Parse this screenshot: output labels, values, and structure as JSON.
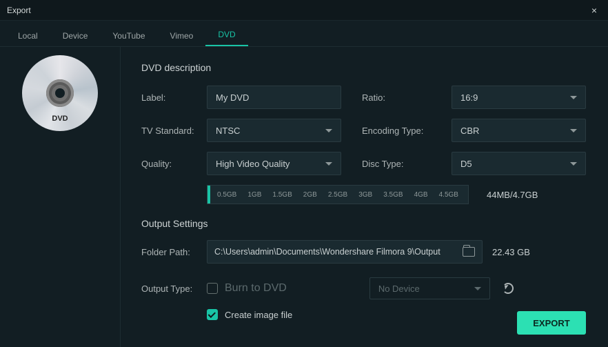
{
  "window": {
    "title": "Export"
  },
  "tabs": {
    "local": "Local",
    "device": "Device",
    "youtube": "YouTube",
    "vimeo": "Vimeo",
    "dvd": "DVD"
  },
  "disc": {
    "label": "DVD"
  },
  "section": {
    "desc": "DVD description",
    "output": "Output Settings"
  },
  "labels": {
    "label": "Label:",
    "tvstd": "TV Standard:",
    "quality": "Quality:",
    "ratio": "Ratio:",
    "encoding": "Encoding Type:",
    "disctype": "Disc Type:",
    "folder": "Folder Path:",
    "outputtype": "Output Type:"
  },
  "values": {
    "label": "My DVD",
    "tvstd": "NTSC",
    "quality": "High Video Quality",
    "ratio": "16:9",
    "encoding": "CBR",
    "disctype": "D5",
    "path": "C:\\Users\\admin\\Documents\\Wondershare Filmora 9\\Output",
    "free": "22.43 GB",
    "size": "44MB/4.7GB",
    "burn": "Burn to DVD",
    "nodevice": "No Device",
    "createimg": "Create image file"
  },
  "gauge": {
    "ticks": [
      "0.5GB",
      "1GB",
      "1.5GB",
      "2GB",
      "2.5GB",
      "3GB",
      "3.5GB",
      "4GB",
      "4.5GB"
    ]
  },
  "export": "EXPORT"
}
